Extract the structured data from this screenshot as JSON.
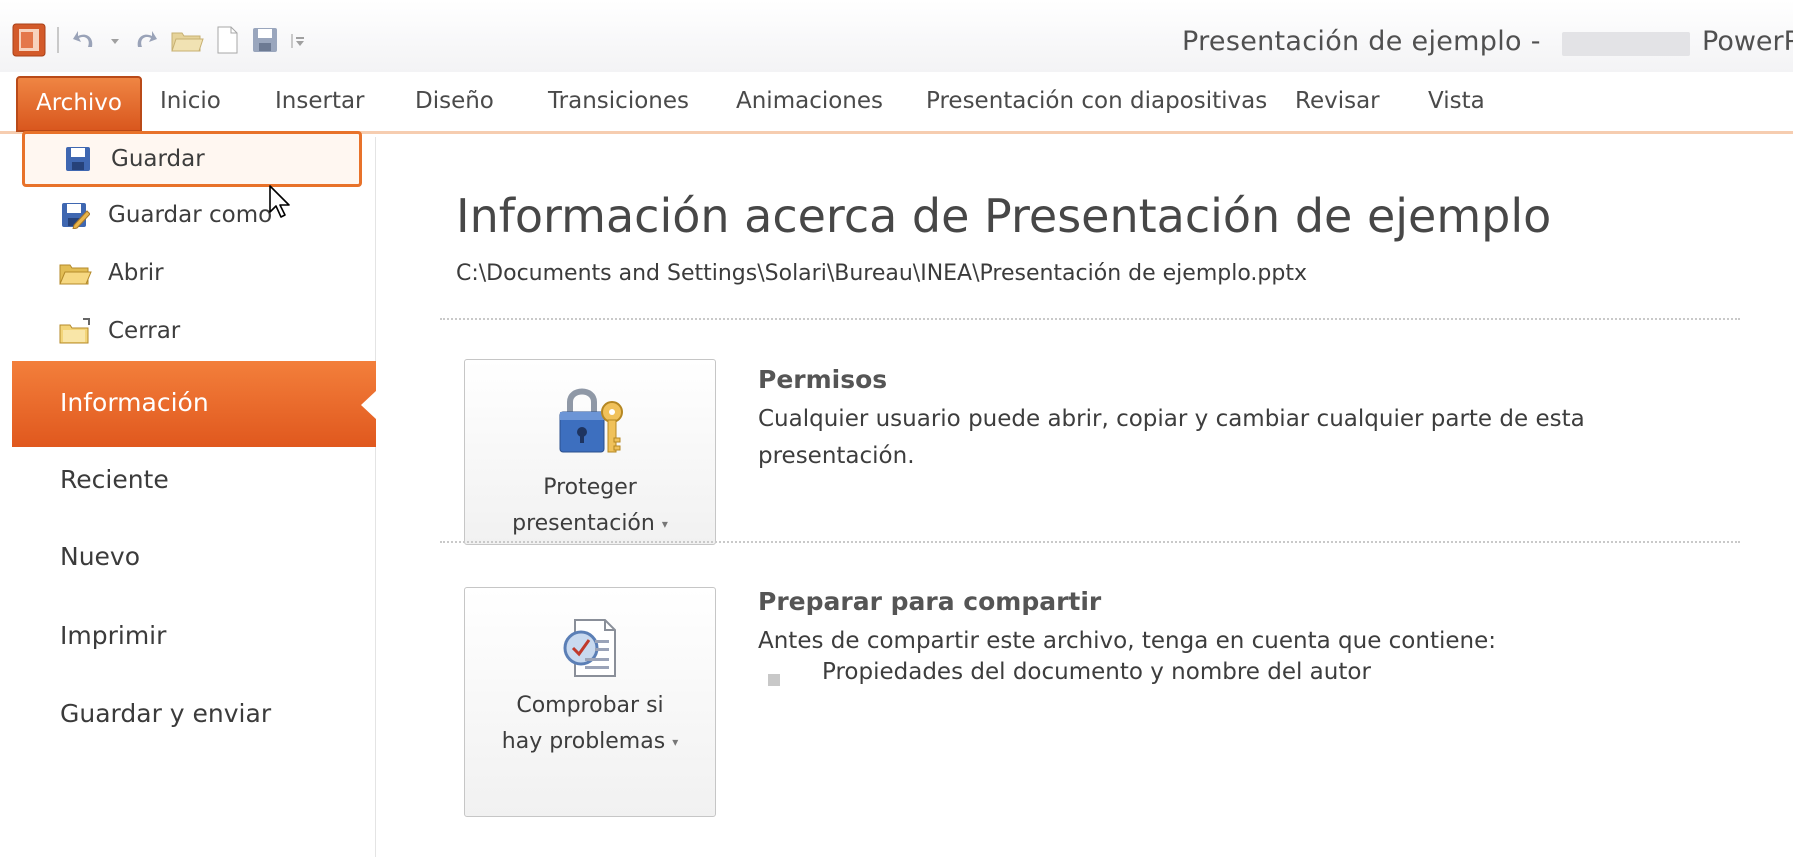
{
  "window": {
    "title": "Presentación de ejemplo -",
    "app_name": "PowerPoint"
  },
  "quick_access": {
    "icons": [
      "powerpoint-app-icon",
      "undo-icon",
      "redo-icon",
      "open-folder-icon",
      "new-document-icon",
      "save-icon",
      "customize-qat-icon"
    ]
  },
  "ribbon": {
    "tabs": [
      {
        "label": "Archivo",
        "active": true
      },
      {
        "label": "Inicio"
      },
      {
        "label": "Insertar"
      },
      {
        "label": "Diseño"
      },
      {
        "label": "Transiciones"
      },
      {
        "label": "Animaciones"
      },
      {
        "label": "Presentación con diapositivas"
      },
      {
        "label": "Revisar"
      },
      {
        "label": "Vista"
      }
    ]
  },
  "backstage": {
    "commands": [
      {
        "label": "Guardar",
        "icon": "save-icon",
        "highlighted": true
      },
      {
        "label": "Guardar como",
        "icon": "save-as-icon"
      },
      {
        "label": "Abrir",
        "icon": "open-folder-icon"
      },
      {
        "label": "Cerrar",
        "icon": "close-folder-icon"
      }
    ],
    "nav": [
      {
        "label": "Información",
        "selected": true
      },
      {
        "label": "Reciente"
      },
      {
        "label": "Nuevo"
      },
      {
        "label": "Imprimir"
      },
      {
        "label": "Guardar y enviar"
      }
    ]
  },
  "info": {
    "heading": "Información acerca de Presentación de ejemplo",
    "path": "C:\\Documents and Settings\\Solari\\Bureau\\INEA\\Presentación de ejemplo.pptx",
    "sections": [
      {
        "button_line1": "Proteger",
        "button_line2": "presentación",
        "button_icon": "lock-key-icon",
        "title": "Permisos",
        "text": "Cualquier usuario puede abrir, copiar y cambiar cualquier parte de esta presentación."
      },
      {
        "button_line1": "Comprobar si",
        "button_line2": "hay problemas",
        "button_icon": "inspect-document-icon",
        "title": "Preparar para compartir",
        "text": "Antes de compartir este archivo, tenga en cuenta que contiene:",
        "bullets": [
          "Propiedades del documento y nombre del autor"
        ]
      }
    ]
  },
  "colors": {
    "accent": "#e8722a",
    "accent_dark": "#d9571e",
    "tab_underline": "#f6cdb0"
  }
}
